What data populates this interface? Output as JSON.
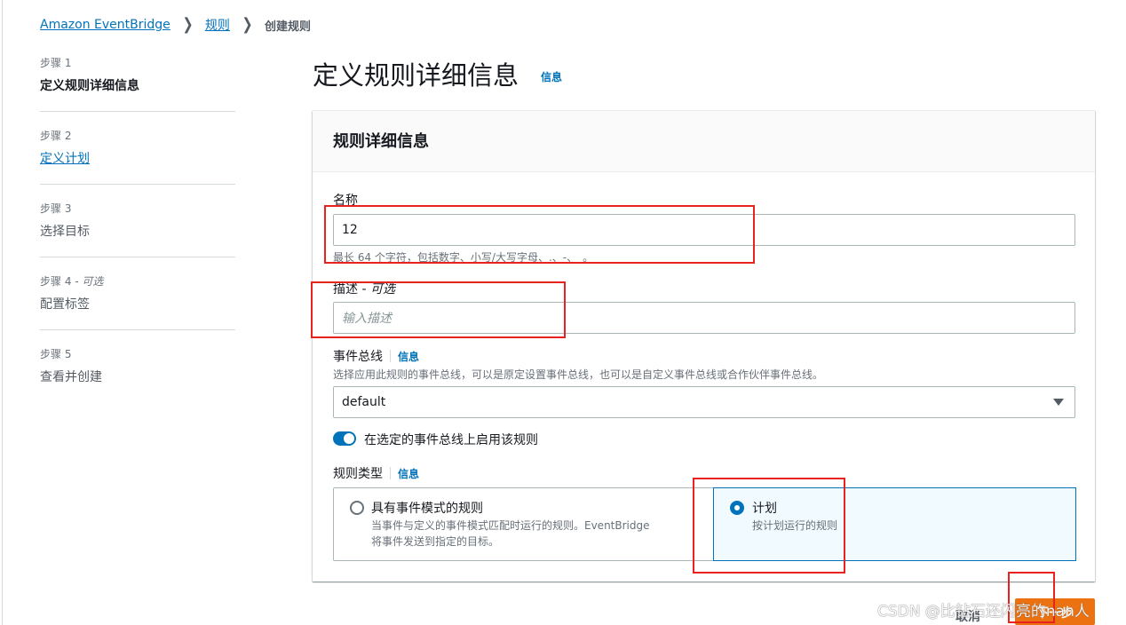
{
  "breadcrumb": {
    "items": [
      "Amazon EventBridge",
      "规则"
    ],
    "current": "创建规则"
  },
  "steps": [
    {
      "label": "步骤 1",
      "optional": "",
      "title": "定义规则详细信息",
      "state": "active"
    },
    {
      "label": "步骤 2",
      "optional": "",
      "title": "定义计划",
      "state": "link"
    },
    {
      "label": "步骤 3",
      "optional": "",
      "title": "选择目标",
      "state": "muted"
    },
    {
      "label": "步骤 4 - ",
      "optional": "可选",
      "title": "配置标签",
      "state": "muted"
    },
    {
      "label": "步骤 5",
      "optional": "",
      "title": "查看并创建",
      "state": "muted"
    }
  ],
  "page": {
    "title": "定义规则详细信息",
    "info": "信息"
  },
  "panel": {
    "title": "规则详细信息",
    "name": {
      "label": "名称",
      "value": "12",
      "hint": "最长 64 个字符，包括数字、小写/大写字母、.、-、_。"
    },
    "description": {
      "label": "描述 - ",
      "optional": "可选",
      "placeholder": "输入描述"
    },
    "event_bus": {
      "label": "事件总线",
      "info": "信息",
      "hint": "选择应用此规则的事件总线，可以是原定设置事件总线，也可以是自定义事件总线或合作伙伴事件总线。",
      "value": "default"
    },
    "enable_toggle": {
      "label": "在选定的事件总线上启用该规则",
      "checked": true
    },
    "rule_type": {
      "label": "规则类型",
      "info": "信息",
      "options": [
        {
          "title": "具有事件模式的规则",
          "desc_line1": "当事件与定义的事件模式匹配时运行的规则。EventBridge",
          "desc_line2": "将事件发送到指定的目标。",
          "selected": false
        },
        {
          "title": "计划",
          "desc_line1": "按计划运行的规则",
          "desc_line2": "",
          "selected": true
        }
      ]
    }
  },
  "footer": {
    "cancel": "取消",
    "next": "下一步"
  },
  "watermark": "CSDN @比钻石还闪亮的nan人",
  "colors": {
    "accent": "#0073bb",
    "primary_button": "#ec7211",
    "annotation": "#e8231f"
  }
}
